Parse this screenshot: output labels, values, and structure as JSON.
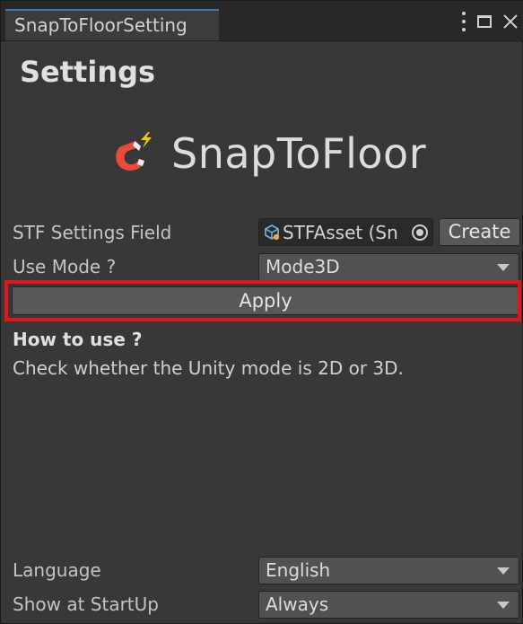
{
  "window": {
    "tab_title": "SnapToFloorSetting"
  },
  "header": {
    "heading": "Settings",
    "logo_text": "SnapToFloor",
    "logo_icon": "magnet-icon"
  },
  "settings_field": {
    "label": "STF Settings Field",
    "value": "STFAsset (Sn",
    "create_label": "Create"
  },
  "use_mode": {
    "label": "Use Mode ?",
    "selected": "Mode3D"
  },
  "apply_label": "Apply",
  "howto": {
    "title": "How to use ?",
    "text": "Check whether the Unity mode is 2D or 3D."
  },
  "language": {
    "label": "Language",
    "selected": "English"
  },
  "startup": {
    "label": "Show at StartUp",
    "selected": "Always"
  },
  "colors": {
    "background": "#383838",
    "tab_accent": "#3a79bb",
    "highlight": "#e8121a",
    "logo_red": "#e84b3c",
    "logo_yellow": "#f5c400"
  }
}
